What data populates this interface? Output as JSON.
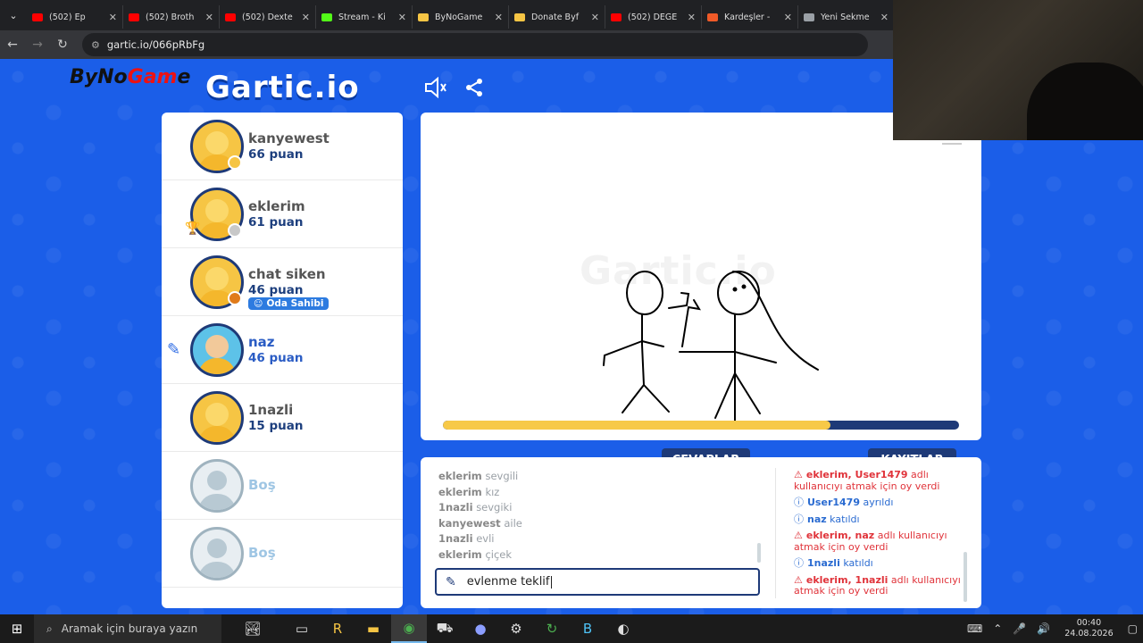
{
  "browser": {
    "tabs": [
      {
        "title": "(502) Ep",
        "color": "#ff0000"
      },
      {
        "title": "(502) Broth",
        "color": "#ff0000"
      },
      {
        "title": "(502) Dexte",
        "color": "#ff0000"
      },
      {
        "title": "Stream - Ki",
        "color": "#53fc18"
      },
      {
        "title": "ByNoGame",
        "color": "#f6c544"
      },
      {
        "title": "Donate Byf",
        "color": "#f6c544"
      },
      {
        "title": "(502) DEĞE",
        "color": "#ff0000"
      },
      {
        "title": "Kardeşler -",
        "color": "#f05a28"
      },
      {
        "title": "Yeni Sekme",
        "color": "#9aa0a6"
      }
    ],
    "url": "gartic.io/066pRbFg"
  },
  "logo": {
    "brand_prefix": "ByNo",
    "brand_mid": "Gam",
    "brand_suffix": "e",
    "gartic": "Gartic.io"
  },
  "players": [
    {
      "name": "kanyewest",
      "points": "66 puan",
      "dot": "#f6c544"
    },
    {
      "name": "eklerim",
      "points": "61 puan",
      "dot": "#c8c8c8",
      "trophy": "2"
    },
    {
      "name": "chat siken",
      "points": "46 puan",
      "dot": "#e07b1a",
      "badge": "Oda Sahibi"
    },
    {
      "name": "naz",
      "points": "46 puan"
    },
    {
      "name": "1nazli",
      "points": "15 puan"
    },
    {
      "name": "Boş"
    },
    {
      "name": "Boş"
    }
  ],
  "canvas": {
    "watermark": "Gartic.io",
    "timer_fraction": 0.75
  },
  "tabs": {
    "answers": "CEVAPLAR",
    "logs": "KAYITLAR"
  },
  "answers": [
    {
      "user": "eklerim",
      "text": "sevgili"
    },
    {
      "user": "eklerim",
      "text": "kız"
    },
    {
      "user": "1nazli",
      "text": "sevgiki"
    },
    {
      "user": "kanyewest",
      "text": "aile"
    },
    {
      "user": "1nazli",
      "text": "evli"
    },
    {
      "user": "eklerim",
      "text": "çiçek"
    }
  ],
  "guess": {
    "value": "evlenme teklif"
  },
  "logs": [
    {
      "type": "red",
      "bold": "eklerim, User1479",
      "text": " adlı kullanıcıyı atmak için oy verdi"
    },
    {
      "type": "blue",
      "bold": "User1479",
      "text": " ayrıldı"
    },
    {
      "type": "blue",
      "bold": "naz",
      "text": " katıldı"
    },
    {
      "type": "red",
      "bold": "eklerim, naz",
      "text": " adlı kullanıcıyı atmak için oy verdi"
    },
    {
      "type": "blue",
      "bold": "1nazli",
      "text": " katıldı"
    },
    {
      "type": "red",
      "bold": "eklerim, 1nazli",
      "text": " adlı kullanıcıyı atmak için oy verdi"
    }
  ],
  "taskbar": {
    "search": "Aramak için buraya yazın",
    "time": "00:40",
    "date": "24.08.2026"
  }
}
